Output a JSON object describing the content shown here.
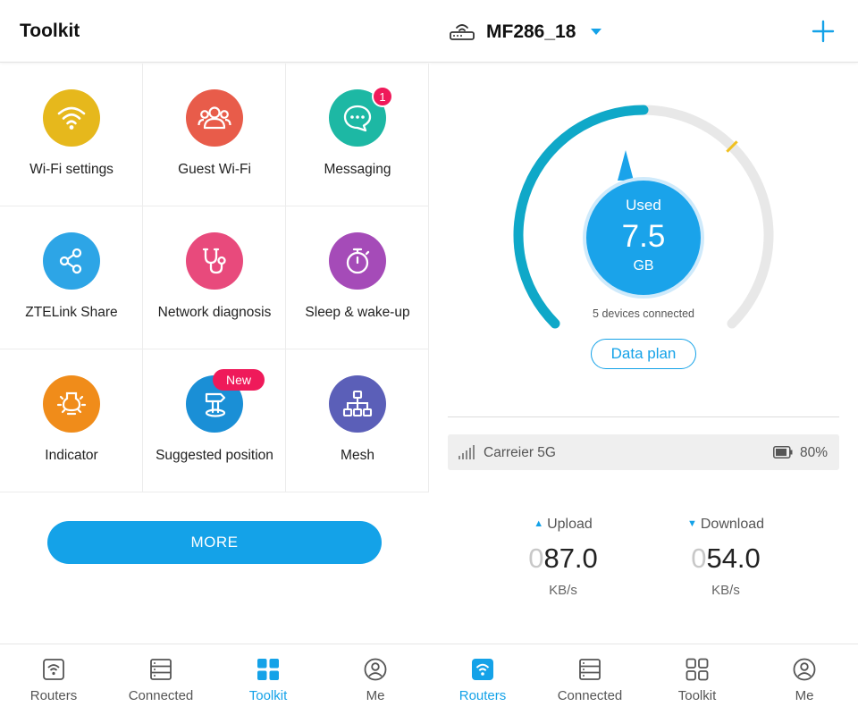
{
  "left": {
    "title": "Toolkit",
    "tools": [
      {
        "label": "Wi-Fi settings",
        "icon": "wifi-icon",
        "color": "#e6b81c"
      },
      {
        "label": "Guest Wi-Fi",
        "icon": "guest-users-icon",
        "color": "#e85c4a"
      },
      {
        "label": "Messaging",
        "icon": "chat-bubble-icon",
        "color": "#1db8a4",
        "badge": "1"
      },
      {
        "label": "ZTELink Share",
        "icon": "share-icon",
        "color": "#2da5e6"
      },
      {
        "label": "Network diagnosis",
        "icon": "stethoscope-icon",
        "color": "#e84a7c"
      },
      {
        "label": "Sleep & wake-up",
        "icon": "stopwatch-icon",
        "color": "#a54bb8"
      },
      {
        "label": "Indicator",
        "icon": "lightbulb-icon",
        "color": "#f08c1a"
      },
      {
        "label": "Suggested position",
        "icon": "signpost-icon",
        "color": "#1a8fd6",
        "badge": "New"
      },
      {
        "label": "Mesh",
        "icon": "mesh-network-icon",
        "color": "#5b5fb8"
      }
    ],
    "more_label": "MORE",
    "tabs": [
      {
        "label": "Routers"
      },
      {
        "label": "Connected"
      },
      {
        "label": "Toolkit"
      },
      {
        "label": "Me"
      }
    ],
    "active_tab": 2
  },
  "right": {
    "router_name": "MF286_18",
    "usage": {
      "label": "Used",
      "value": "7.5",
      "unit": "GB",
      "fill_fraction": 0.5
    },
    "devices_text": "5 devices connected",
    "plan_label": "Data plan",
    "carrier": "Carreier 5G",
    "battery": "80%",
    "upload": {
      "label": "Upload",
      "lead": "0",
      "value": "87.0",
      "unit": "KB/s"
    },
    "download": {
      "label": "Download",
      "lead": "0",
      "value": "54.0",
      "unit": "KB/s"
    },
    "tabs": [
      {
        "label": "Routers"
      },
      {
        "label": "Connected"
      },
      {
        "label": "Toolkit"
      },
      {
        "label": "Me"
      }
    ],
    "active_tab": 0
  },
  "colors": {
    "accent": "#14a2e8",
    "badge": "#ef1a5a",
    "gauge_fill": "#0fa8c8",
    "gauge_track": "#e8e8e8",
    "gauge_marker": "#f0c020"
  }
}
